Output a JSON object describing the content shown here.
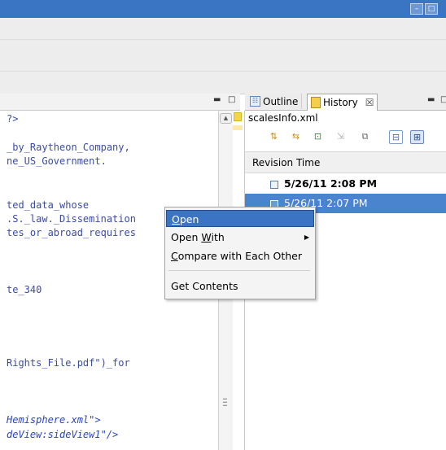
{
  "window": {
    "minimize_glyph": "–",
    "maximize_glyph": "□"
  },
  "editor": {
    "lines": [
      {
        "text": "?>"
      },
      {
        "text": "_by_Raytheon_Company,"
      },
      {
        "text": "ne_US_Government."
      },
      {
        "text": "ted_data_whose"
      },
      {
        "text": ".S._law._Dissemination"
      },
      {
        "text": "tes_or_abroad_requires"
      },
      {
        "text": "te_340"
      },
      {
        "text": "Rights_File.pdf\")_for"
      },
      {
        "text": "Hemisphere.xml\">"
      },
      {
        "text": "deView:sideView1\"/>"
      }
    ]
  },
  "right_panel": {
    "tabs": [
      {
        "label": "Outline",
        "icon": "outline-icon"
      },
      {
        "label": "History",
        "icon": "history-icon",
        "close": "☒"
      }
    ],
    "file_name": "scalesInfo.xml",
    "column_header": "Revision Time",
    "revisions": [
      {
        "label": "5/26/11 2:08 PM",
        "current": true
      },
      {
        "label": "5/26/11 2:07 PM",
        "selected": true
      }
    ]
  },
  "context_menu": {
    "items": [
      {
        "label": "Open",
        "mnemonic": "O",
        "rest": "pen"
      },
      {
        "label": "Open With",
        "prefix": "Open ",
        "mnemonic": "W",
        "rest": "ith",
        "submenu": true
      },
      {
        "label": "Compare with Each Other",
        "mnemonic": "C",
        "rest": "ompare with Each Other"
      },
      {
        "label": "Get Contents"
      }
    ]
  },
  "colors": {
    "title_bar": "#3a75c4",
    "selection": "#4a84cf",
    "menu_highlight": "#3c74c4",
    "code_text": "#3b4ba8"
  }
}
